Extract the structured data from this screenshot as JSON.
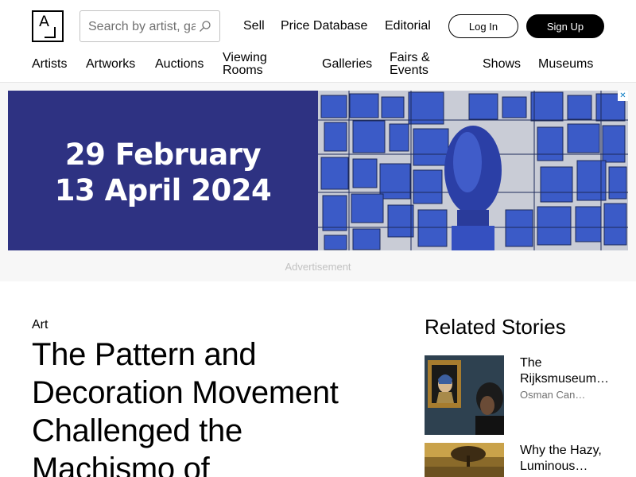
{
  "header": {
    "logo_letter": "A",
    "search": {
      "placeholder": "Search by artist, gallery, style, theme, tag, etc.",
      "value": ""
    },
    "top_links": [
      "Sell",
      "Price Database",
      "Editorial"
    ],
    "login_label": "Log In",
    "signup_label": "Sign Up",
    "nav": [
      "Artists",
      "Artworks",
      "Auctions",
      "Viewing Rooms",
      "Galleries",
      "Fairs & Events",
      "Shows",
      "Museums"
    ],
    "nav_split": {
      "viewing_rooms": [
        "Viewing",
        "Rooms"
      ],
      "fairs_events": [
        "Fairs &",
        "Events"
      ]
    }
  },
  "ad": {
    "date_line_1": "29 February",
    "date_line_2": "13 April 2024",
    "close_symbol": "✕",
    "label": "Advertisement",
    "colors": {
      "background": "#2e3282",
      "tile_blue": "#3b5bc7"
    }
  },
  "article": {
    "category": "Art",
    "title": "The Pattern and Decoration Movement Challenged the Machismo of"
  },
  "related": {
    "heading": "Related Stories",
    "stories": [
      {
        "title": "The Rijksmuseum…",
        "author": "Osman Can…",
        "thumb": "vermeer-painting-with-visitor"
      },
      {
        "title": "Why the Hazy, Luminous…",
        "author": "",
        "thumb": "hazy-landscape-painting"
      }
    ]
  }
}
